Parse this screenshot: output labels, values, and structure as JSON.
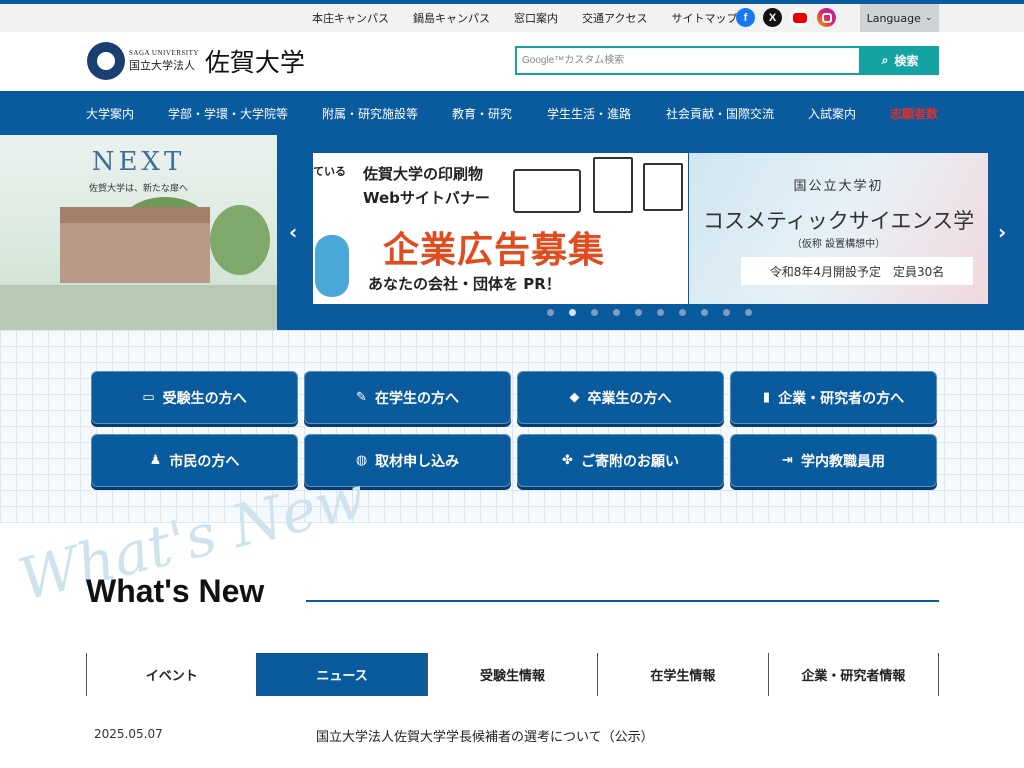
{
  "utility": {
    "links": [
      "本庄キャンパス",
      "鍋島キャンパス",
      "窓口案内",
      "交通アクセス",
      "サイトマップ"
    ],
    "language_label": "Language"
  },
  "header": {
    "logo_en": "SAGA UNIVERSITY",
    "logo_corp": "国立大学法人",
    "logo_name": "佐賀大学",
    "search_placeholder": "Google™カスタム検索",
    "search_button": "検索"
  },
  "nav": {
    "items": [
      "大学案内",
      "学部・学環・大学院等",
      "附属・研究施設等",
      "教育・研究",
      "学生生活・進路",
      "社会貢献・国際交流",
      "入試案内",
      "志願者数"
    ]
  },
  "hero": {
    "poster_next": "NEXT",
    "poster_sub": "佐賀大学は、新たな扉へ",
    "banner_left": "ている",
    "banner_line1": "佐賀大学の印刷物",
    "banner_line2": "Webサイトバナー",
    "banner_big": "企業広告募集",
    "banner_bottom": "あなたの会社・団体を PR！",
    "banner2_line1": "国公立大学初",
    "banner2_line2": "コスメティックサイエンス学",
    "banner2_line3": "（仮称 設置構想中）",
    "banner2_line4": "令和8年4月開設予定　定員30名",
    "prev_arrow": "‹",
    "next_arrow": "›",
    "dot_count": 10,
    "active_dot": 1
  },
  "quick_links": [
    {
      "label": "受験生の方へ",
      "icon": "book-icon"
    },
    {
      "label": "在学生の方へ",
      "icon": "pencil-icon"
    },
    {
      "label": "卒業生の方へ",
      "icon": "graduation-cap-icon"
    },
    {
      "label": "企業・研究者の方へ",
      "icon": "building-icon"
    },
    {
      "label": "市民の方へ",
      "icon": "people-icon"
    },
    {
      "label": "取材申し込み",
      "icon": "globe-icon"
    },
    {
      "label": "ご寄附のお願い",
      "icon": "clover-icon"
    },
    {
      "label": "学内教職員用",
      "icon": "login-icon"
    }
  ],
  "whats_new": {
    "title": "What's New",
    "script": "What's New",
    "tabs": [
      "イベント",
      "ニュース",
      "受験生情報",
      "在学生情報",
      "企業・研究者情報"
    ],
    "active_tab": 1,
    "news": [
      {
        "date": "2025.05.07",
        "title": "国立大学法人佐賀大学学長候補者の選考について（公示）"
      }
    ]
  },
  "colors": {
    "brand_blue": "#0a5a9e",
    "search_teal": "#13a3a3",
    "alert_red": "#e0312a"
  }
}
